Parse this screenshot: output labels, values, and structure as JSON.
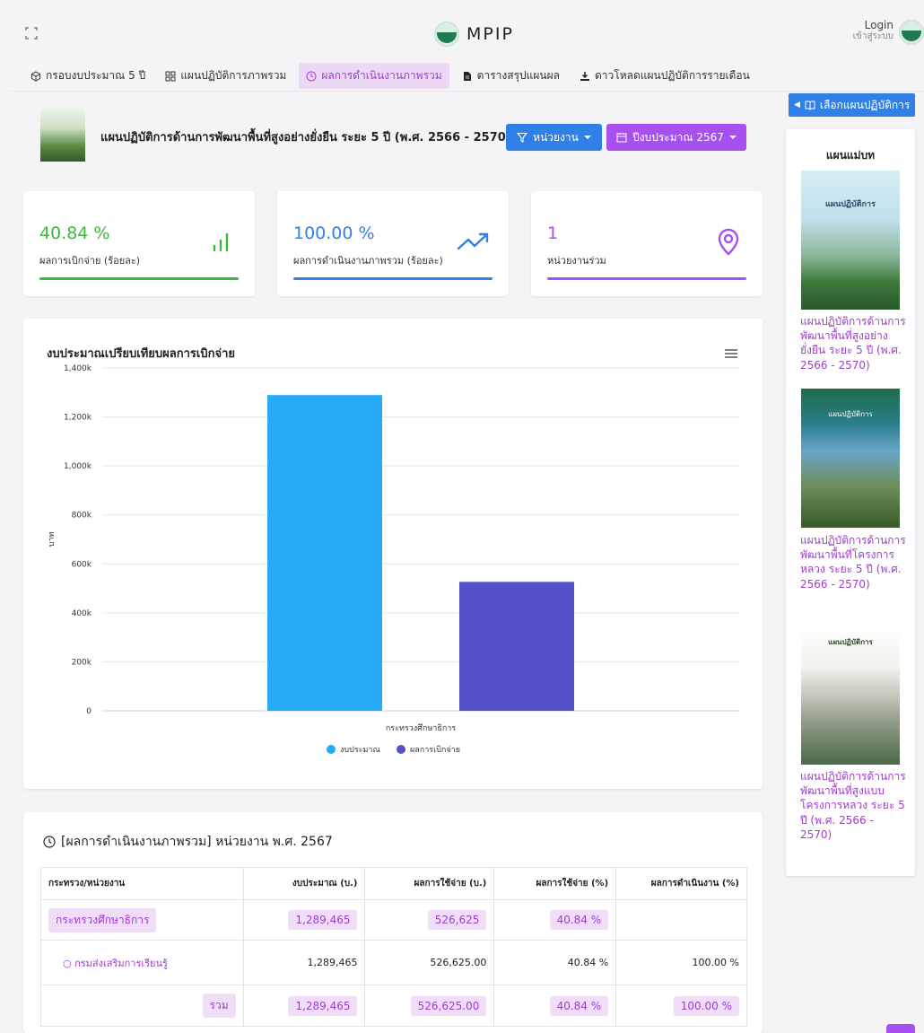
{
  "app": {
    "name": "MPIP",
    "login": "Login",
    "login_sub": "เข้าสู่ระบบ"
  },
  "nav": [
    {
      "label": "กรอบงบประมาณ 5 ปี",
      "icon": "box-icon"
    },
    {
      "label": "แผนปฏิบัติการภาพรวม",
      "icon": "grid-icon"
    },
    {
      "label": "ผลการดำเนินงานภาพรวม",
      "icon": "clock-icon",
      "active": true
    },
    {
      "label": "ตารางสรุปแผนผล",
      "icon": "document-icon"
    },
    {
      "label": "ดาวโหลดแผนปฏิบัติการรายเดือน",
      "icon": "download-icon"
    }
  ],
  "select_plan": {
    "label": "เลือกแผนปฏิบัติการ"
  },
  "plan": {
    "title": "แผนปฏิบัติการด้านการพัฒนาพื้นที่สูงอย่างยั่งยืน ระยะ 5 ปี (พ.ศ. 2566 - 2570)"
  },
  "filters": {
    "agency": "หน่วยงาน",
    "year": "ปีงบประมาณ 2567"
  },
  "stats": [
    {
      "value": "40.84 %",
      "label": "ผลการเบิกจ่าย (ร้อยละ)",
      "color": "#3cb93c",
      "icon": "bar-chart-icon"
    },
    {
      "value": "100.00 %",
      "label": "ผลการดำเนินงานภาพรวม (ร้อยละ)",
      "color": "#2f80e8",
      "icon": "trend-up-icon"
    },
    {
      "value": "1",
      "label": "หน่วยงานร่วม",
      "color": "#a74ff0",
      "icon": "location-pin-icon"
    }
  ],
  "chart_data": {
    "type": "bar",
    "title": "งบประมาณเปรียบเทียบผลการเบิกจ่าย",
    "categories": [
      "กระทรวงศึกษาธิการ"
    ],
    "series": [
      {
        "name": "งบประมาณ",
        "values": [
          1289465
        ],
        "color": "#27aaf5"
      },
      {
        "name": "ผลการเบิกจ่าย",
        "values": [
          526625
        ],
        "color": "#5350c8"
      }
    ],
    "ylabel": "บาท",
    "ylim": [
      0,
      1400000
    ],
    "yticks": [
      "0",
      "200k",
      "400k",
      "600k",
      "800k",
      "1,000k",
      "1,200k",
      "1,400k"
    ],
    "grid": true,
    "legend": "bottom"
  },
  "table": {
    "title": "[ผลการดำเนินงานภาพรวม] หน่วยงาน พ.ศ. 2567",
    "headers": [
      "กระทรวง/หน่วยงาน",
      "งบประมาณ (บ.)",
      "ผลการใช้จ่าย (บ.)",
      "ผลการใช้จ่าย (%)",
      "ผลการดำเนินงาน (%)"
    ],
    "ministry": {
      "name": "กระทรวงศึกษาธิการ",
      "budget": "1,289,465",
      "spent": "526,625",
      "spent_pct": "40.84 %",
      "perf": ""
    },
    "agency": {
      "name": "กรมส่งเสริมการเรียนรู้",
      "budget": "1,289,465",
      "spent": "526,625.00",
      "spent_pct": "40.84 %",
      "perf": "100.00 %"
    },
    "total": {
      "name": "รวม",
      "budget": "1,289,465",
      "spent": "526,625.00",
      "spent_pct": "40.84 %",
      "perf": "100.00 %"
    }
  },
  "sidebar": {
    "title": "แผนแม่บท",
    "books": [
      {
        "label": "แผนปฏิบัติการด้านการพัฒนาพื้นที่สูงอย่างยั่งยืน ระยะ 5 ปี (พ.ศ. 2566 - 2570)",
        "cover_title": "แผนปฏิบัติการ"
      },
      {
        "label": "แผนปฏิบัติการด้านการพัฒนาพื้นที่โครงการหลวง ระยะ 5 ปี (พ.ศ. 2566 - 2570)",
        "cover_title": "แผนปฏิบัติการ"
      },
      {
        "label": "แผนปฏิบัติการด้านการพัฒนาพื้นที่สูงแบบโครงการหลวง ระยะ 5 ปี (พ.ศ. 2566 - 2570)",
        "cover_title": "แผนปฏิบัติการ"
      }
    ]
  }
}
